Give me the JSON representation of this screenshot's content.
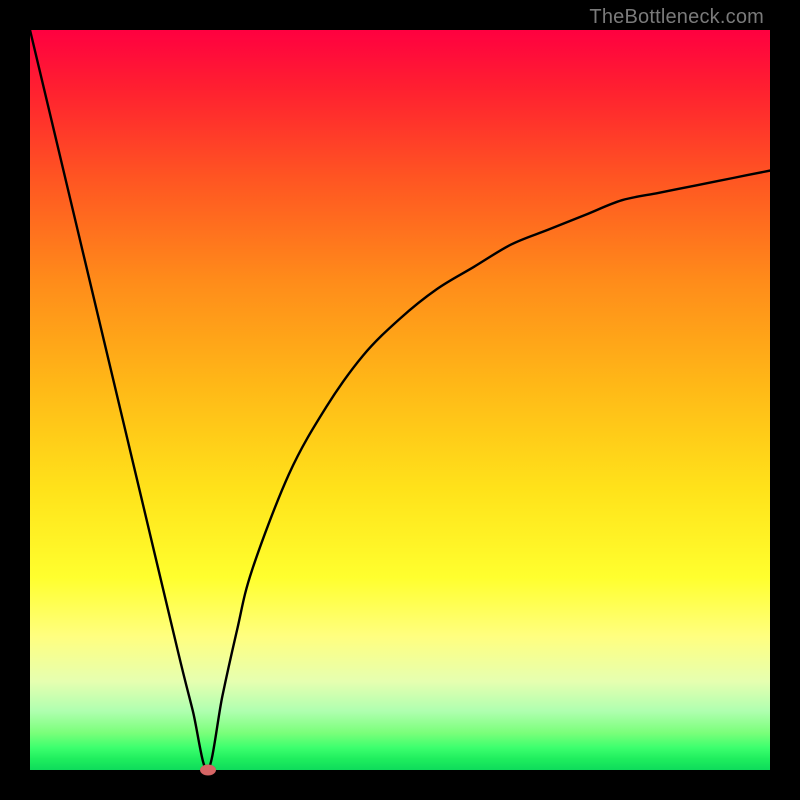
{
  "attribution": "TheBottleneck.com",
  "colors": {
    "frame_border": "#000000",
    "curve_stroke": "#000000",
    "marker_fill": "#d66565",
    "gradient_top": "#ff0040",
    "gradient_bottom": "#0edb5b",
    "attribution_text": "#7a7a7a"
  },
  "chart_data": {
    "type": "line",
    "title": "",
    "xlabel": "",
    "ylabel": "",
    "xlim": [
      0,
      100
    ],
    "ylim": [
      0,
      100
    ],
    "notes": "V-shaped bottleneck curve with minimum near x≈24. Left branch descends nearly linearly from (0,100) to the minimum; right branch rises with diminishing slope toward ~81 at x=100. No axis ticks or labels are rendered.",
    "series": [
      {
        "name": "bottleneck-curve",
        "x": [
          0,
          5,
          10,
          15,
          20,
          22,
          24,
          26,
          28,
          30,
          35,
          40,
          45,
          50,
          55,
          60,
          65,
          70,
          75,
          80,
          85,
          90,
          95,
          100
        ],
        "y": [
          100,
          79,
          58,
          37,
          16,
          8,
          0,
          10,
          19,
          27,
          40,
          49,
          56,
          61,
          65,
          68,
          71,
          73,
          75,
          77,
          78,
          79,
          80,
          81
        ]
      }
    ],
    "marker": {
      "x": 24,
      "y": 0
    }
  }
}
